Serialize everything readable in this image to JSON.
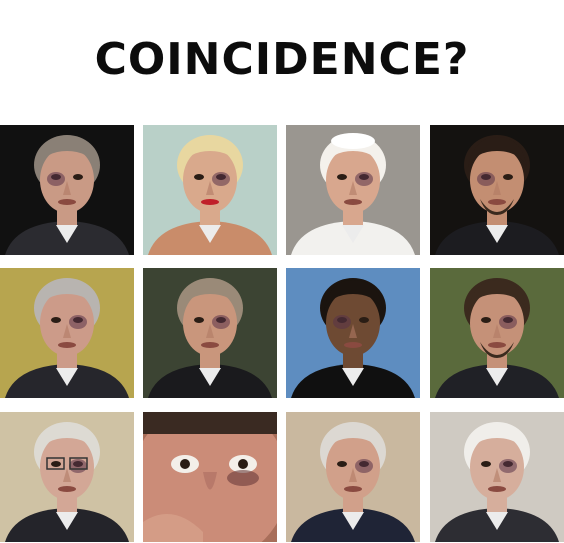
{
  "title": "COINCIDENCE?",
  "grid": {
    "rows": 3,
    "columns": 4,
    "cells": [
      {
        "subject": "man-dark-suit-bruised-eye",
        "bg": "#111111",
        "skin": "#c99a85",
        "hair": "#8a8076",
        "clothes": "#2b2b30"
      },
      {
        "subject": "blonde-woman-red-lips-bruised-eye",
        "bg": "#b9d0c8",
        "skin": "#d9a98c",
        "hair": "#e8d7a0",
        "clothes": "#c98c6a"
      },
      {
        "subject": "pope-white-cap-bruised-eye",
        "bg": "#9a9690",
        "skin": "#d8a78e",
        "hair": "#f4f1ec",
        "clothes": "#f2f1ee"
      },
      {
        "subject": "man-goatee-bruised-eye",
        "bg": "#141210",
        "skin": "#c38e72",
        "hair": "#2a1d16",
        "clothes": "#1c1c20"
      },
      {
        "subject": "grey-haired-man-bruised-eye",
        "bg": "#b7a54f",
        "skin": "#cc9b89",
        "hair": "#b8b4b0",
        "clothes": "#26262c"
      },
      {
        "subject": "man-dark-jacket-bruised-eye",
        "bg": "#3c4433",
        "skin": "#c9967c",
        "hair": "#9a8a78",
        "clothes": "#1a1a1d"
      },
      {
        "subject": "man-blue-backdrop-bruised-eye",
        "bg": "#5e8dc0",
        "skin": "#6e4a33",
        "hair": "#1b140f",
        "clothes": "#101010"
      },
      {
        "subject": "bearded-man-bruised-eye",
        "bg": "#5a6a3c",
        "skin": "#c59178",
        "hair": "#3b2a1e",
        "clothes": "#202126"
      },
      {
        "subject": "man-glasses-bruised-eye",
        "bg": "#cfc2a4",
        "skin": "#d3a796",
        "hair": "#dddad3",
        "clothes": "#24242a"
      },
      {
        "subject": "man-closeup-finger-bruised-eye",
        "bg": "#a86e5a",
        "skin": "#cb8c78",
        "hair": "#3a2a22",
        "clothes": "#a86e5a"
      },
      {
        "subject": "elderly-man-smiling-bruised-eye",
        "bg": "#c9b89f",
        "skin": "#d1a08a",
        "hair": "#dcd8d2",
        "clothes": "#1f2436"
      },
      {
        "subject": "elderly-man-white-hair-scar",
        "bg": "#cfcac2",
        "skin": "#d6ae9c",
        "hair": "#f0eeea",
        "clothes": "#2d2d33"
      }
    ]
  }
}
